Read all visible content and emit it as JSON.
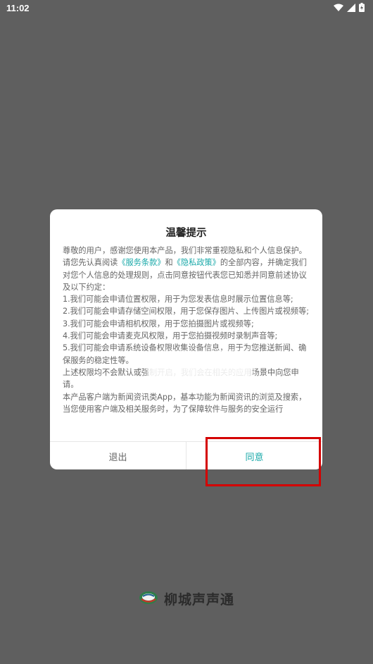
{
  "status_bar": {
    "time": "11:02"
  },
  "dialog": {
    "title": "温馨提示",
    "para1_a": "尊敬的用户，感谢您使用本产品，我们非常重视隐私和个人信息保护。请您先认真阅读",
    "terms_link": "《服务条款》",
    "para1_b": "和",
    "privacy_link": "《隐私政策》",
    "para1_c": "的全部内容，并确定我们对您个人信息的处理规则，点击同意按钮代表您已知悉并同意前述协议及以下约定：",
    "items": [
      "1.我们可能会申请位置权限，用于为您发表信息时展示位置信息等;",
      "2.我们可能会申请存储空间权限，用于您保存图片、上传图片或视频等;",
      "3.我们可能会申请相机权限，用于您拍摄图片或视频等;",
      "4.我们可能会申请麦克风权限，用于您拍摄视频时录制声音等;",
      "5.我们可能会申请系统设备权限收集设备信息，用于为您推送新闻、确保服务的稳定性等。"
    ],
    "para2": "上述权限均不会默认或强制开启，我们会在相关的应用场景中向您申请。",
    "para3": "本产品客户端为新闻资讯类App，基本功能为新闻资讯的浏览及搜索，当您使用客户端及相关服务时，为了保障软件与服务的安全运行",
    "exit_label": "退出",
    "agree_label": "同意"
  },
  "brand": {
    "name": "柳城声声通"
  },
  "colors": {
    "accent": "#1aa9a9",
    "highlight": "#d40000",
    "overlay": "#5f5f5f"
  }
}
